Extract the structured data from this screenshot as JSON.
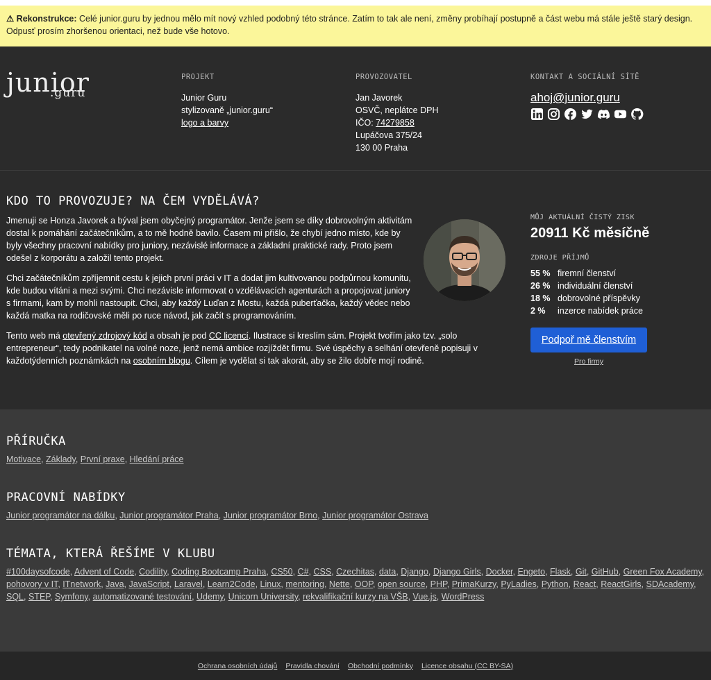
{
  "banner": {
    "label": "⚠ Rekonstrukce:",
    "text": " Celé junior.guru by jednou mělo mít nový vzhled podobný této stránce. Zatím to tak ale není, změny probíhají postupně a část webu má stále ještě starý design. Odpusť prosím zhoršenou orientaci, než bude vše hotovo."
  },
  "logo": {
    "main": "junior",
    "sub": ".guru"
  },
  "project": {
    "heading": "PROJEKT",
    "name": "Junior Guru",
    "styled": "stylizovaně „junior.guru“",
    "logo_link": "logo a barvy"
  },
  "operator": {
    "heading": "PROVOZOVATEL",
    "name": "Jan Javorek",
    "vat": "OSVČ, neplátce DPH",
    "ico_label": "IČO: ",
    "ico": "74279858",
    "street": "Lupáčova 375/24",
    "city": "130 00 Praha"
  },
  "contact": {
    "heading": "KONTAKT A SOCIÁLNÍ SÍTĚ",
    "email": "ahoj@junior.guru",
    "icons": [
      "linkedin-icon",
      "instagram-icon",
      "facebook-icon",
      "twitter-icon",
      "discord-icon",
      "youtube-icon",
      "github-icon"
    ]
  },
  "about": {
    "title": "KDO TO PROVOZUJE? NA ČEM VYDĚLÁVÁ?",
    "p1": "Jmenuji se Honza Javorek a býval jsem obyčejný programátor. Jenže jsem se díky dobrovolným aktivitám dostal k pomáhání začátečníkům, a to mě hodně bavilo. Časem mi přišlo, že chybí jedno místo, kde by byly všechny pracovní nabídky pro juniory, nezávislé informace a základní praktické rady. Proto jsem odešel z korporátu a založil tento projekt.",
    "p2": "Chci začátečníkům zpříjemnit cestu k jejich první práci v IT a dodat jim kultivovanou podpůrnou komunitu, kde budou vítáni a mezi svými. Chci nezávisle informovat o vzdělávacích agenturách a propojovat juniory s firmami, kam by mohli nastoupit. Chci, aby každý Luďan z Mostu, každá puberťačka, každý vědec nebo každá matka na rodičovské měli po ruce návod, jak začít s programováním.",
    "p3a": "Tento web má ",
    "p3_link1": "otevřený zdrojový kód",
    "p3b": " a obsah je pod ",
    "p3_link2": "CC licencí",
    "p3c": ". Ilustrace si kreslím sám. Projekt tvořím jako tzv. „solo entrepreneur“, tedy podnikatel na volné noze, jenž nemá ambice rozjíždět firmu. Své úspěchy a selhání otevřeně popisuji v každotýdenních poznámkách na ",
    "p3_link3": "osobním blogu",
    "p3d": ". Cílem je vydělat si tak akorát, aby se žilo dobře mojí rodině."
  },
  "income": {
    "label": "MŮJ AKTUÁLNÍ ČISTÝ ZISK",
    "value": "20911 Kč měsíčně",
    "sources_label": "ZDROJE PŘÍJMŮ",
    "sources": [
      {
        "pct": "55 %",
        "name": "firemní členství"
      },
      {
        "pct": "26 %",
        "name": "individuální členství"
      },
      {
        "pct": "18 %",
        "name": "dobrovolné příspěvky"
      },
      {
        "pct": "2 %",
        "name": "inzerce nabídek práce"
      }
    ],
    "cta": "Podpoř mě členstvím",
    "firms": "Pro firmy"
  },
  "handbook": {
    "title": "PŘÍRUČKA",
    "items": [
      "Motivace",
      "Základy",
      "První praxe",
      "Hledání práce"
    ]
  },
  "jobs": {
    "title": "PRACOVNÍ NABÍDKY",
    "items": [
      "Junior programátor na dálku",
      "Junior programátor Praha",
      "Junior programátor Brno",
      "Junior programátor Ostrava"
    ]
  },
  "topics": {
    "title": "TÉMATA, KTERÁ ŘEŠÍME V KLUBU",
    "items": [
      "#100daysofcode",
      "Advent of Code",
      "Codility",
      "Coding Bootcamp Praha",
      "CS50",
      "C#",
      "CSS",
      "Czechitas",
      "data",
      "Django",
      "Django Girls",
      "Docker",
      "Engeto",
      "Flask",
      "Git",
      "GitHub",
      "Green Fox Academy",
      "pohovory v IT",
      "ITnetwork",
      "Java",
      "JavaScript",
      "Laravel",
      "Learn2Code",
      "Linux",
      "mentoring",
      "Nette",
      "OOP",
      "open source",
      "PHP",
      "PrimaKurzy",
      "PyLadies",
      "Python",
      "React",
      "ReactGirls",
      "SDAcademy",
      "SQL",
      "STEP",
      "Symfony",
      "automatizované testování",
      "Udemy",
      "Unicorn University",
      "rekvalifikační kurzy na VŠB",
      "Vue.js",
      "WordPress"
    ]
  },
  "footer": {
    "links": [
      "Ochrana osobních údajů",
      "Pravidla chování",
      "Obchodní podmínky",
      "Licence obsahu (CC BY-SA)"
    ]
  }
}
